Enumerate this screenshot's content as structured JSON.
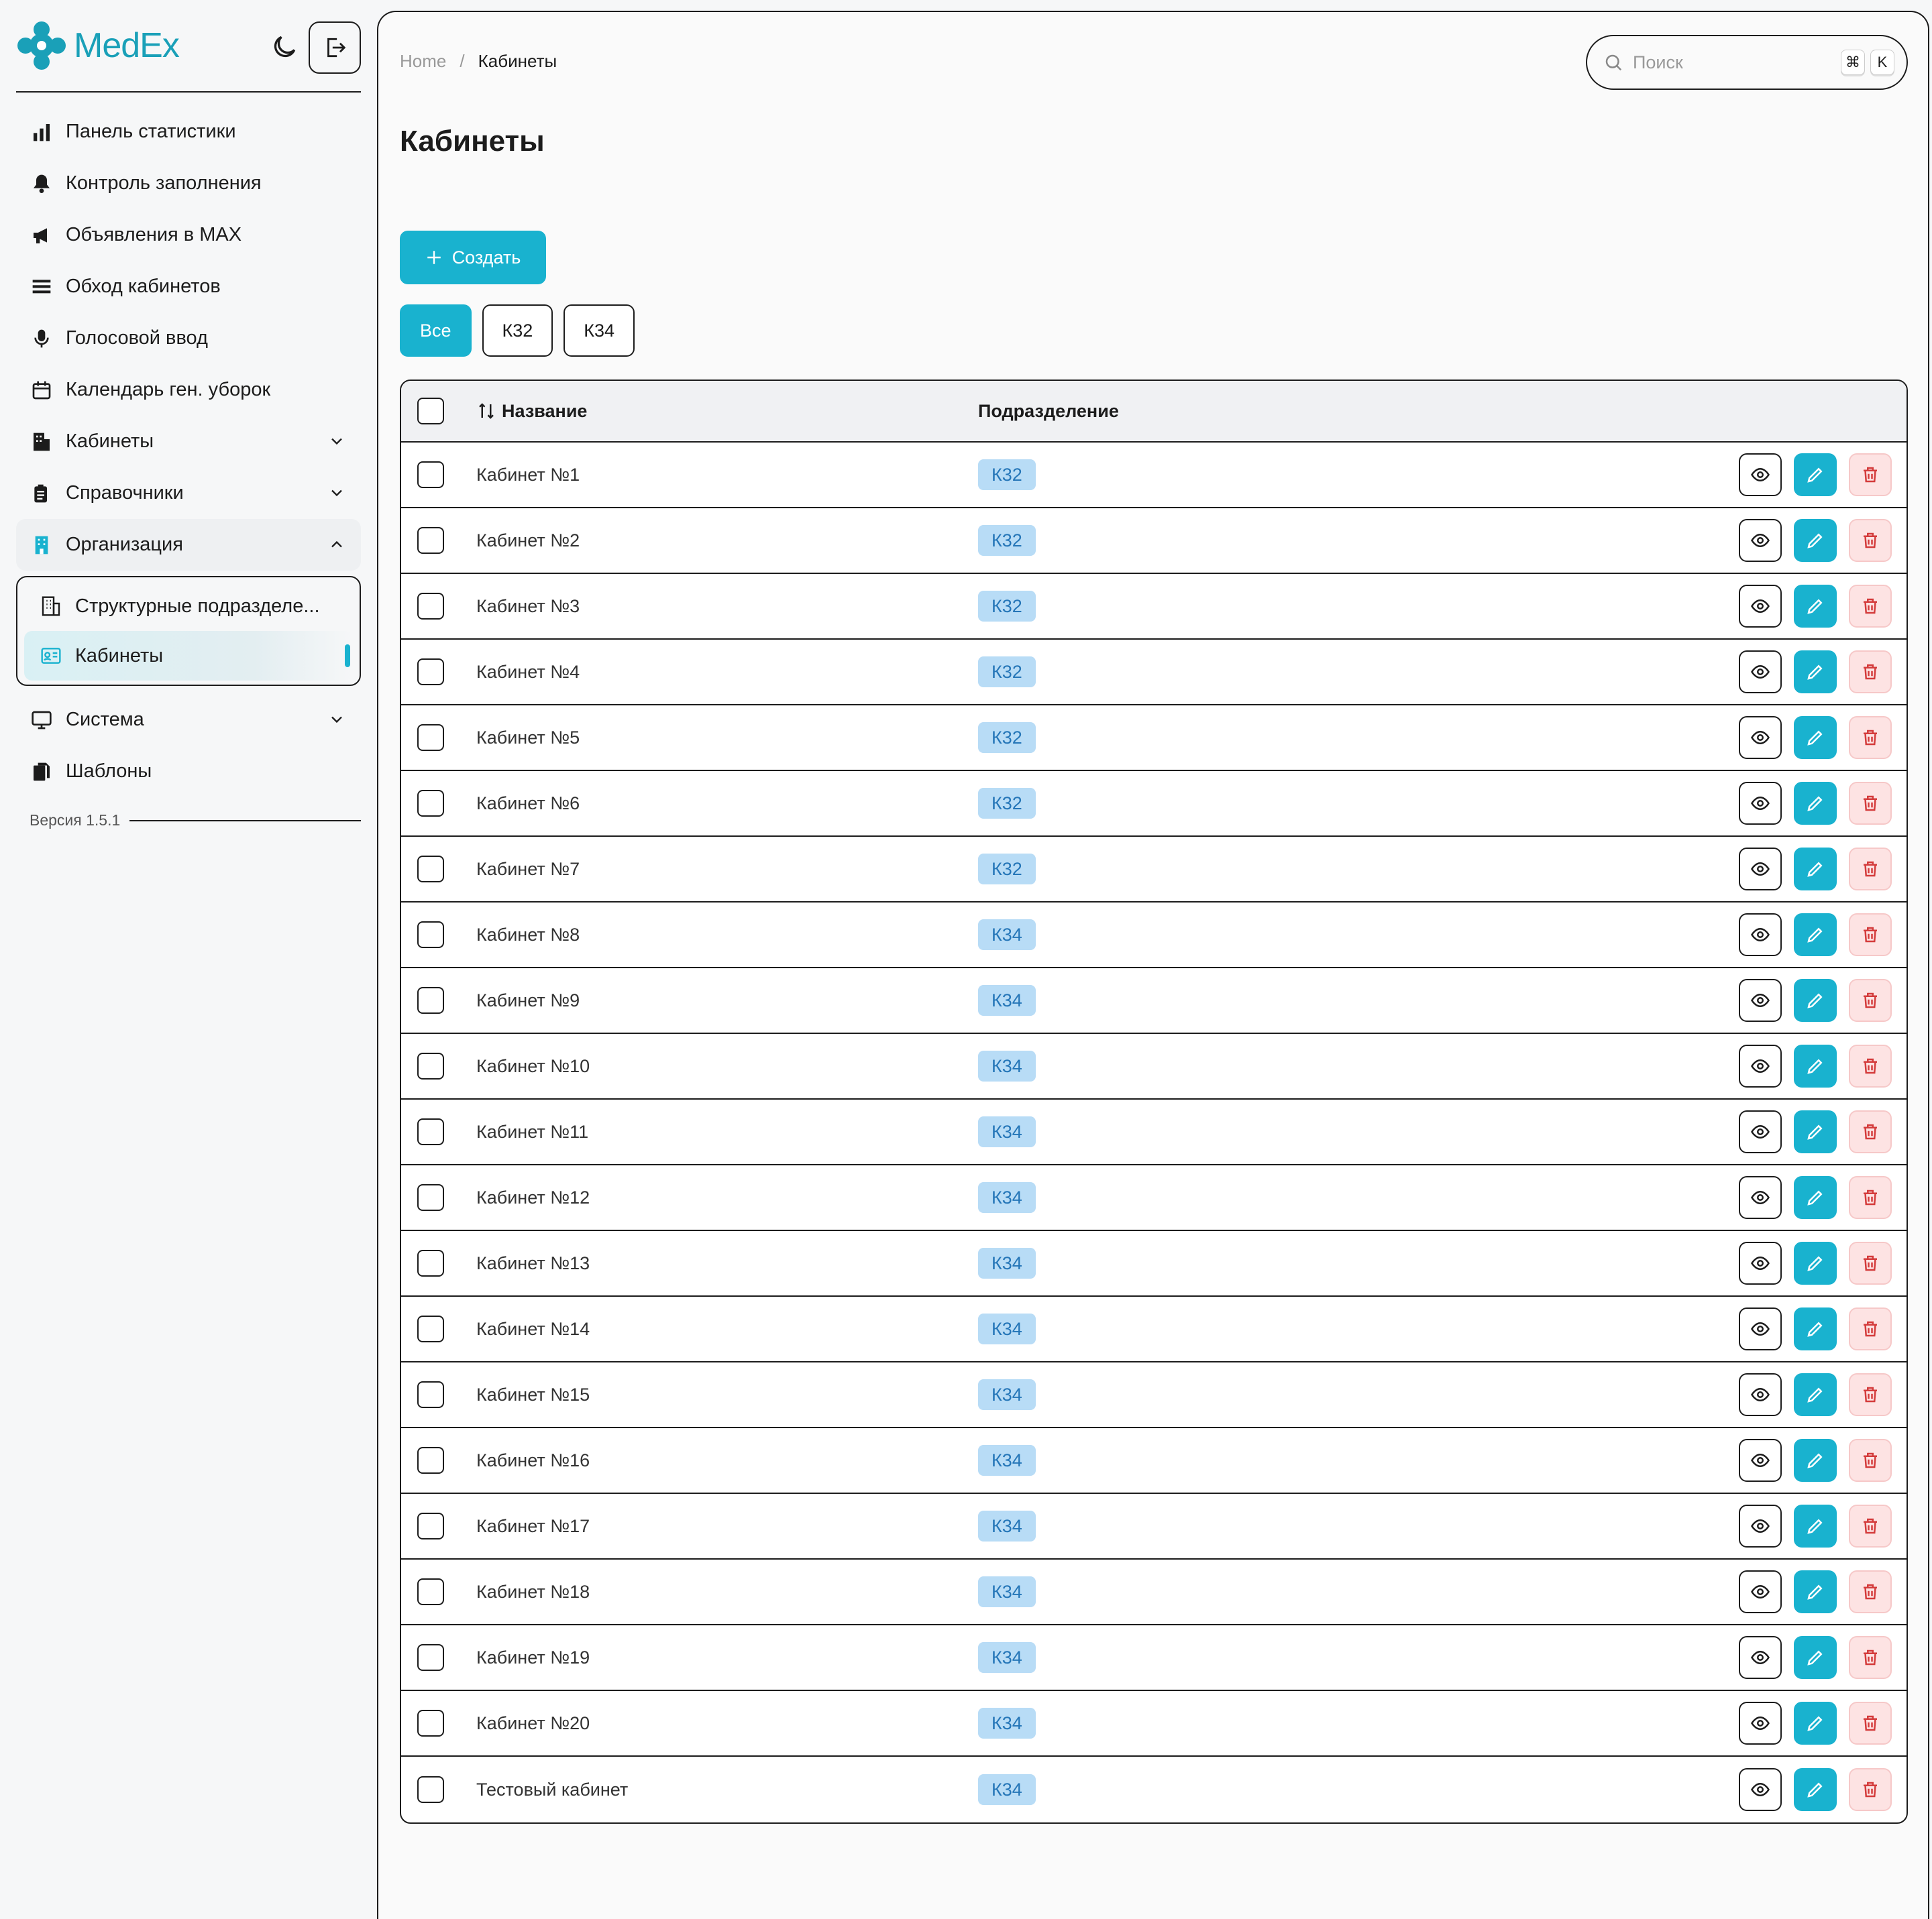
{
  "app": {
    "logo_text": "MedEx",
    "brand_color": "#19b2cf"
  },
  "sidebar": {
    "items": [
      {
        "label": "Панель статистики",
        "icon": "chart-bars-icon"
      },
      {
        "label": "Контроль заполнения",
        "icon": "bell-icon"
      },
      {
        "label": "Объявления в MAX",
        "icon": "megaphone-icon"
      },
      {
        "label": "Обход кабинетов",
        "icon": "layers-icon"
      },
      {
        "label": "Голосовой ввод",
        "icon": "microphone-icon"
      },
      {
        "label": "Календарь ген. уборок",
        "icon": "calendar-icon"
      },
      {
        "label": "Кабинеты",
        "icon": "building-icon"
      },
      {
        "label": "Справочники",
        "icon": "clipboard-icon"
      },
      {
        "label": "Организация",
        "icon": "organization-icon"
      },
      {
        "label": "Система",
        "icon": "monitor-icon"
      },
      {
        "label": "Шаблоны",
        "icon": "documents-icon"
      }
    ],
    "submenu": [
      {
        "label": "Структурные подразделе...",
        "icon": "building-outline-icon"
      },
      {
        "label": "Кабинеты",
        "icon": "id-card-icon"
      }
    ],
    "version": "Версия 1.5.1"
  },
  "breadcrumb": {
    "home": "Home",
    "sep": "/",
    "current": "Кабинеты"
  },
  "search": {
    "placeholder": "Поиск",
    "kbd1": "⌘",
    "kbd2": "K"
  },
  "page": {
    "title": "Кабинеты",
    "create_label": "Создать"
  },
  "filters": [
    "Все",
    "К32",
    "К34"
  ],
  "table": {
    "headers": {
      "name": "Название",
      "division": "Подразделение"
    },
    "rows": [
      {
        "name": "Кабинет №1",
        "division": "К32"
      },
      {
        "name": "Кабинет №2",
        "division": "К32"
      },
      {
        "name": "Кабинет №3",
        "division": "К32"
      },
      {
        "name": "Кабинет №4",
        "division": "К32"
      },
      {
        "name": "Кабинет №5",
        "division": "К32"
      },
      {
        "name": "Кабинет №6",
        "division": "К32"
      },
      {
        "name": "Кабинет №7",
        "division": "К32"
      },
      {
        "name": "Кабинет №8",
        "division": "К34"
      },
      {
        "name": "Кабинет №9",
        "division": "К34"
      },
      {
        "name": "Кабинет №10",
        "division": "К34"
      },
      {
        "name": "Кабинет №11",
        "division": "К34"
      },
      {
        "name": "Кабинет №12",
        "division": "К34"
      },
      {
        "name": "Кабинет №13",
        "division": "К34"
      },
      {
        "name": "Кабинет №14",
        "division": "К34"
      },
      {
        "name": "Кабинет №15",
        "division": "К34"
      },
      {
        "name": "Кабинет №16",
        "division": "К34"
      },
      {
        "name": "Кабинет №17",
        "division": "К34"
      },
      {
        "name": "Кабинет №18",
        "division": "К34"
      },
      {
        "name": "Кабинет №19",
        "division": "К34"
      },
      {
        "name": "Кабинет №20",
        "division": "К34"
      },
      {
        "name": "Тестовый кабинет",
        "division": "К34"
      }
    ]
  }
}
